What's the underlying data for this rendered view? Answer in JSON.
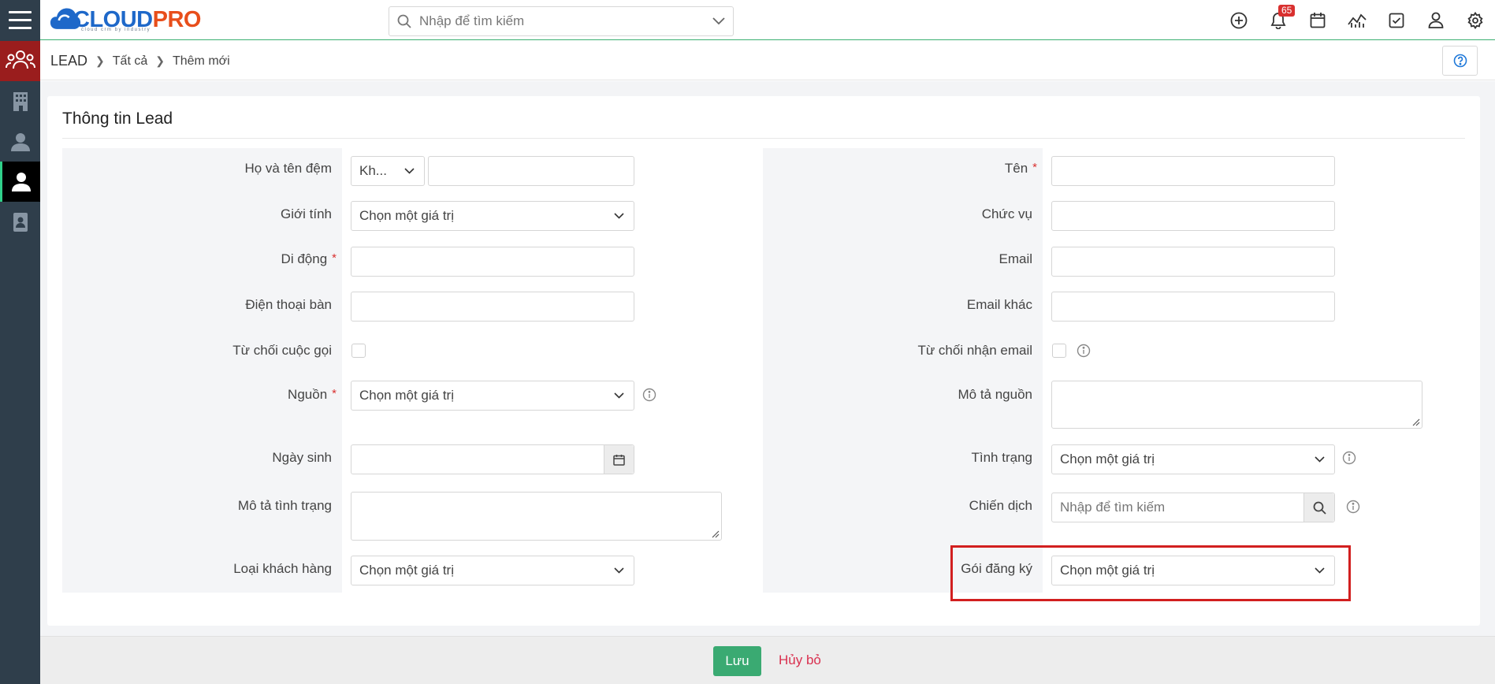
{
  "app": {
    "brand_part1": "CLOUD",
    "brand_part2": "PRO",
    "brand_tagline": "cloud crm by industry",
    "brand_color": "#1e68c9",
    "accent_color": "#3aaa72"
  },
  "search": {
    "placeholder": "Nhập để tìm kiếm"
  },
  "header": {
    "notification_count": "65",
    "icons": [
      "add-circle-icon",
      "bell-icon",
      "calendar-icon",
      "chart-icon",
      "checkbox-icon",
      "user-icon",
      "gear-icon"
    ]
  },
  "sidebar": {
    "items": [
      "leads-group-icon",
      "building-icon",
      "contact-icon",
      "person-icon",
      "document-person-icon"
    ]
  },
  "breadcrumb": {
    "root": "LEAD",
    "level1": "Tất cả",
    "level2": "Thêm mới"
  },
  "form": {
    "title": "Thông tin Lead",
    "left": {
      "name_label": "Họ và tên đệm",
      "salutation_value": "Kh...",
      "gender_label": "Giới tính",
      "gender_value": "Chọn một giá trị",
      "mobile_label": "Di động",
      "phone_label": "Điện thoại bàn",
      "reject_call_label": "Từ chối cuộc gọi",
      "source_label": "Nguồn",
      "source_value": "Chọn một giá trị",
      "birthday_label": "Ngày sinh",
      "status_desc_label": "Mô tả tình trạng",
      "customer_type_label": "Loại khách hàng",
      "customer_type_value": "Chọn một giá trị"
    },
    "right": {
      "first_name_label": "Tên",
      "position_label": "Chức vụ",
      "email_label": "Email",
      "email_other_label": "Email khác",
      "reject_email_label": "Từ chối nhận email",
      "source_desc_label": "Mô tả nguồn",
      "status_label": "Tình trạng",
      "status_value": "Chọn một giá trị",
      "campaign_label": "Chiến dịch",
      "campaign_placeholder": "Nhập để tìm kiếm",
      "package_label": "Gói đăng ký",
      "package_value": "Chọn một giá trị"
    },
    "required_mark": "*"
  },
  "footer": {
    "save_label": "Lưu",
    "cancel_label": "Hủy bỏ"
  }
}
